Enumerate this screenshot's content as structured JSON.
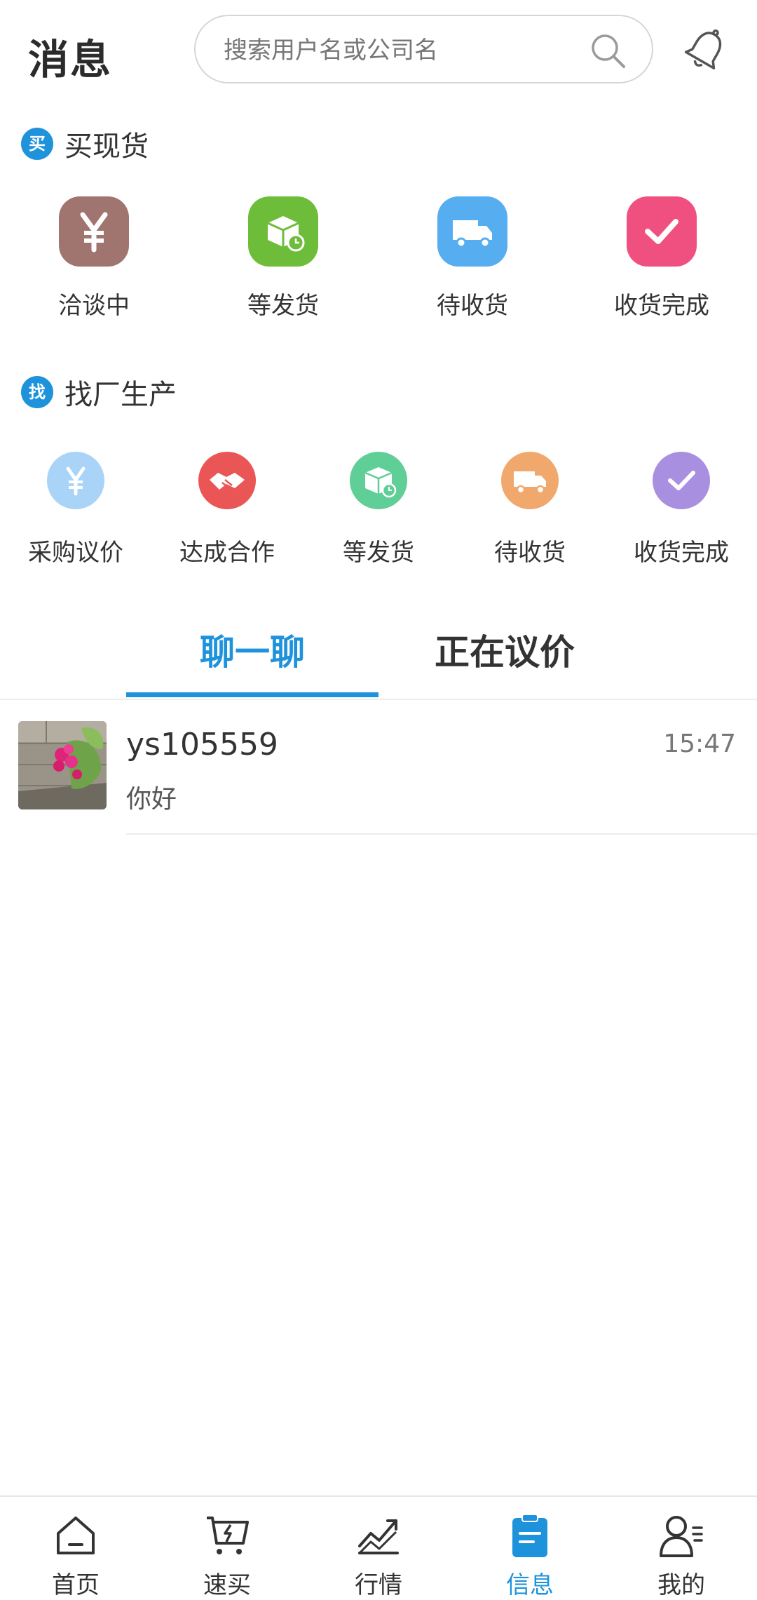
{
  "header": {
    "title": "消息",
    "search_placeholder": "搜索用户名或公司名"
  },
  "buy_section": {
    "badge": "买",
    "title": "买现货",
    "items": [
      {
        "label": "洽谈中",
        "icon": "yen-icon",
        "color": "#a07570"
      },
      {
        "label": "等发货",
        "icon": "package-clock-icon",
        "color": "#6ebd3a"
      },
      {
        "label": "待收货",
        "icon": "truck-icon",
        "color": "#56aef0"
      },
      {
        "label": "收货完成",
        "icon": "check-icon",
        "color": "#f0507f"
      }
    ]
  },
  "factory_section": {
    "badge": "找",
    "title": "找厂生产",
    "items": [
      {
        "label": "采购议价",
        "icon": "yen-icon",
        "color": "#a9d3f7"
      },
      {
        "label": "达成合作",
        "icon": "handshake-icon",
        "color": "#ea5556"
      },
      {
        "label": "等发货",
        "icon": "package-clock-icon",
        "color": "#5fcf97"
      },
      {
        "label": "待收货",
        "icon": "truck-icon",
        "color": "#f0a86c"
      },
      {
        "label": "收货完成",
        "icon": "check-icon",
        "color": "#a98fe0"
      }
    ]
  },
  "tabs": [
    {
      "label": "聊一聊",
      "active": true
    },
    {
      "label": "正在议价",
      "active": false
    }
  ],
  "conversations": [
    {
      "name": "ys105559",
      "time": "15:47",
      "message": "你好"
    }
  ],
  "bottom_nav": [
    {
      "label": "首页",
      "icon": "home-icon"
    },
    {
      "label": "速买",
      "icon": "quick-buy-cart-icon"
    },
    {
      "label": "行情",
      "icon": "trend-chart-icon"
    },
    {
      "label": "信息",
      "icon": "message-clipboard-icon",
      "active": true
    },
    {
      "label": "我的",
      "icon": "profile-icon"
    }
  ],
  "colors": {
    "accent": "#1e93dc",
    "text": "#333333",
    "muted": "#777777"
  }
}
